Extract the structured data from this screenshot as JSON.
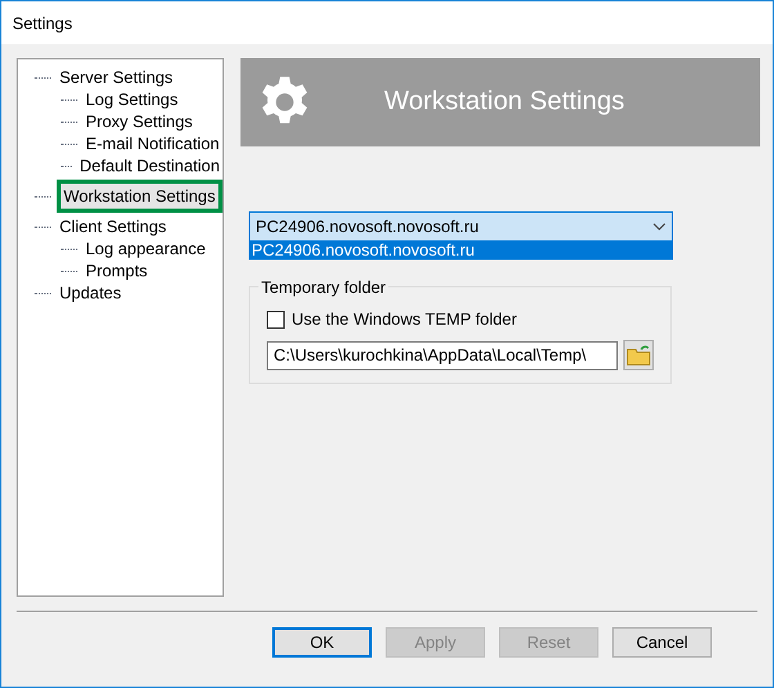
{
  "window": {
    "title": "Settings"
  },
  "tree": [
    {
      "label": "Server Settings",
      "selected": false,
      "children": [
        {
          "label": "Log Settings",
          "selected": false
        },
        {
          "label": "Proxy Settings",
          "selected": false
        },
        {
          "label": "E-mail Notification",
          "selected": false
        },
        {
          "label": "Default Destination",
          "selected": false
        }
      ]
    },
    {
      "label": "Workstation Settings",
      "selected": true
    },
    {
      "label": "Client Settings",
      "selected": false,
      "children": [
        {
          "label": "Log appearance",
          "selected": false
        },
        {
          "label": "Prompts",
          "selected": false
        }
      ]
    },
    {
      "label": "Updates",
      "selected": false
    }
  ],
  "header": {
    "title": "Workstation Settings"
  },
  "workstation": {
    "value": "PC24906.novosoft.novosoft.ru",
    "expanded": true,
    "options": [
      {
        "label": "PC24906.novosoft.novosoft.ru",
        "selected": true
      }
    ]
  },
  "temp_group": {
    "title": "Temporary folder",
    "use_windows_temp": {
      "label": "Use the Windows TEMP folder",
      "checked": false
    },
    "path": "C:\\Users\\kurochkina\\AppData\\Local\\Temp\\"
  },
  "buttons": [
    {
      "label": "OK",
      "disabled": false,
      "default": true
    },
    {
      "label": "Apply",
      "disabled": true,
      "default": false
    },
    {
      "label": "Reset",
      "disabled": true,
      "default": false
    },
    {
      "label": "Cancel",
      "disabled": false,
      "default": false
    }
  ]
}
